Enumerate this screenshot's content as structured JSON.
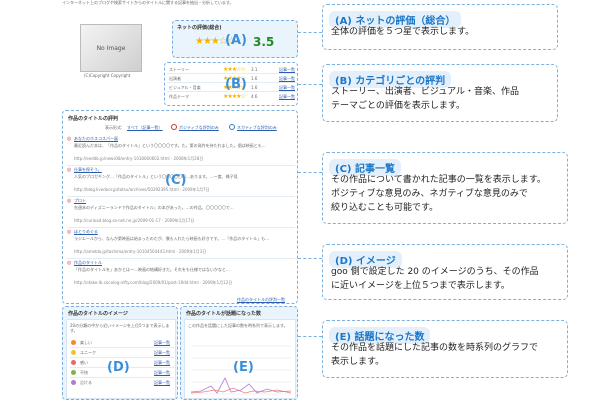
{
  "header_text": "インターネット上のブログや検索サイトからのタイトルに関する記事を抽出・分析しています。",
  "image": {
    "placeholder": "No Image",
    "copyright": "(C)Copyright Copyright"
  },
  "overall": {
    "label": "ネットの評価(総合)",
    "score": "3.5",
    "stars": "★★★☆☆",
    "marker": "(A)"
  },
  "categories": {
    "marker": "(B)",
    "link_label": "記事一覧",
    "rows": [
      {
        "name": "ストーリー",
        "stars": "★★★☆☆",
        "score": "3.1"
      },
      {
        "name": "出演者",
        "stars": "★★★★☆",
        "score": "1.6"
      },
      {
        "name": "ビジュアル・音楽",
        "stars": "★★★★☆",
        "score": "1.6"
      },
      {
        "name": "作品テーマ",
        "stars": "★★★★☆",
        "score": "4.6"
      }
    ]
  },
  "reviews": {
    "title": "作品のタイトルの評判",
    "marker": "(C)",
    "filter_label": "表示形式:",
    "filter_all": "すべて（記事一覧）",
    "filter_positive": "ポジティブな評判のみ",
    "filter_negative": "ネガティブな評判のみ",
    "items": [
      {
        "title": "あなたのホスコスパー展",
        "body": "最近読んだ本は、「作品のタイトル」という〇〇〇〇です。た。第の発作を持たれました。個は映画とも…",
        "url": "http://eeddb.jp/news08/entry-1018060602.html · 2008年1月28日"
      },
      {
        "title": "仕事を探そう。",
        "body": "人気のブロガギング…「作品のタイトル」という〇〇〇〇〇〇…あります。…一度、様子見",
        "url": "http://blog.livedoor.jp/tatsu/archives/50292395.html · 2009年1月7日"
      },
      {
        "title": "プロト",
        "body": "先週末のディズニーランドで作品のタイトル」の本があった。…の作品、〇〇〇〇〇で…",
        "url": "http://curioad.blog.so-net.ne.jp/2009-01-17 · 2009年1月17日"
      },
      {
        "title": "ほとりめぐる",
        "body": "ラジエールから、なんか第映画は始まったのだが、僕も入れたら映画も好きです。…「作品のタイトル」も…",
        "url": "http://ameblo.jp/tashima/entry-10104504443.html · 2009年1月3日"
      },
      {
        "title": "作品のタイトル",
        "body": "「作品のタイトルを」あかとはー…映画の結構好きだ。それをも仕様ではないかなと…",
        "url": "http://otake-lb.cocolog-nifty.com/blog/2009/01/post-19dd.html · 2009年1月12日"
      }
    ],
    "more_link": "作品のタイトルの評判一覧"
  },
  "images_panel": {
    "title": "作品のタイトルのイメージ",
    "marker": "(D)",
    "desc": "20の分類の中から近いイメージを上位5つまで表示します。",
    "link_label": "記事一覧",
    "items": [
      {
        "name": "楽しい",
        "color": "#f08a2c"
      },
      {
        "name": "ユニーク",
        "color": "#e8c53a"
      },
      {
        "name": "感い",
        "color": "#e46a6a"
      },
      {
        "name": "不快",
        "color": "#7fb24a"
      },
      {
        "name": "泣ける",
        "color": "#b07bd0"
      }
    ]
  },
  "buzz_panel": {
    "title": "作品のタイトルが話題になった数",
    "marker": "(E)",
    "desc": "この作品を話題にした記事の数を時系列で表示します。"
  },
  "callouts": [
    {
      "title": "(A) ネットの評価（総合）",
      "lines": [
        "全体の評価を５つ星で表示します。"
      ]
    },
    {
      "title": "(B) カテゴリごとの評判",
      "lines": [
        "ストーリー、出演者、ビジュアル・音楽、作品",
        "テーマごとの評価を表示します。"
      ]
    },
    {
      "title": "(C) 記事一覧",
      "lines": [
        "その作品について書かれた記事の一覧を表示します。",
        "ポジティブな意見のみ、ネガティブな意見のみで",
        "絞り込むことも可能です。"
      ]
    },
    {
      "title": "(D) イメージ",
      "lines": [
        "goo 側で設定した 20 のイメージのうち、その作品",
        "に近いイメージを上位５つまで表示します。"
      ]
    },
    {
      "title": "(E) 話題になった数",
      "lines": [
        "その作品を話題にした記事の数を時系列のグラフで",
        "表示します。"
      ]
    }
  ]
}
